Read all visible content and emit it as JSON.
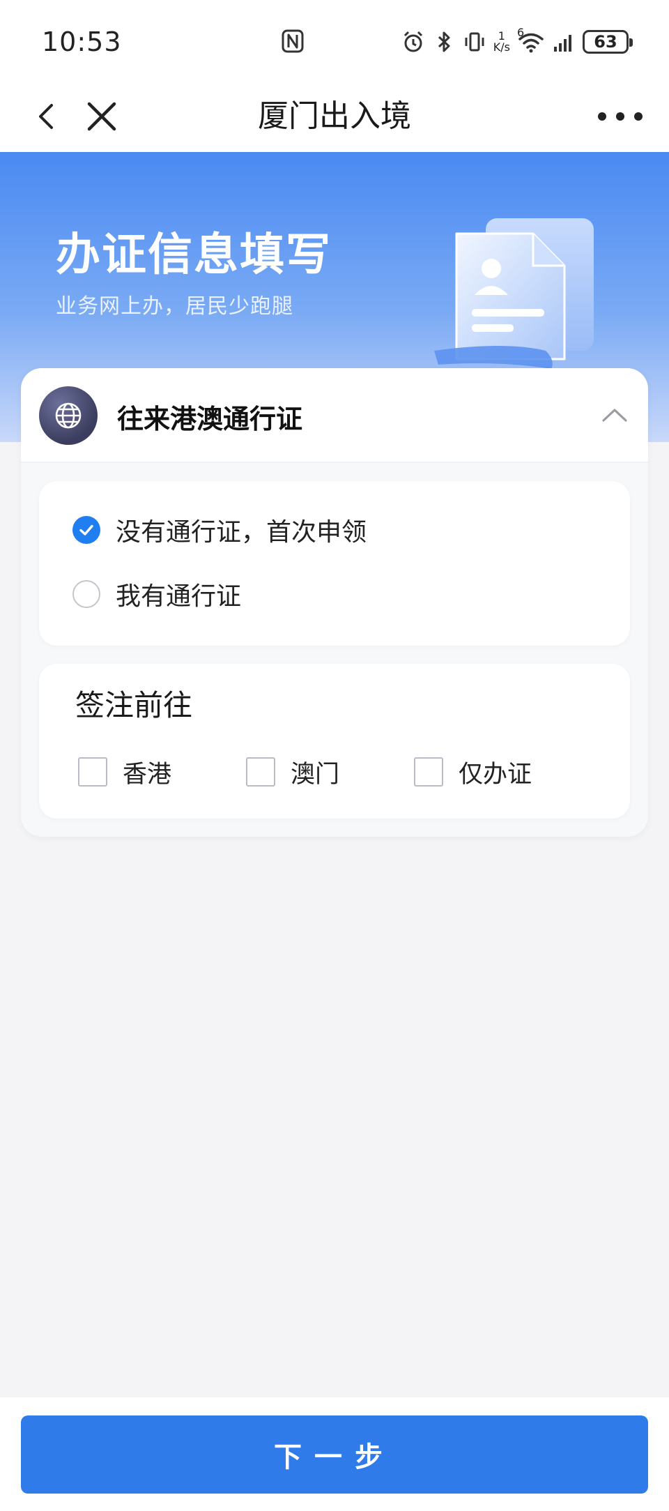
{
  "status_bar": {
    "time": "10:53",
    "net_speed_value": "1",
    "net_speed_unit": "K/s",
    "signal_label": "6",
    "battery": "63",
    "icons": [
      "nfc-icon",
      "alarm-icon",
      "bluetooth-icon",
      "vibrate-icon",
      "wifi-icon",
      "cell-signal-icon",
      "battery-icon"
    ]
  },
  "nav": {
    "title": "厦门出入境",
    "back_icon": "chevron-left-icon",
    "close_icon": "close-icon",
    "more_icon": "more-dots-icon"
  },
  "hero": {
    "title": "办证信息填写",
    "subtitle": "业务网上办，居民少跑腿",
    "accent_top": "#4a8af2",
    "accent_bottom": "#c9d8fa"
  },
  "card": {
    "title": "往来港澳通行证",
    "badge_icon": "globe-icon",
    "toggle_icon": "chevron-up-icon",
    "options": [
      {
        "label": "没有通行证，首次申领",
        "checked": true
      },
      {
        "label": "我有通行证",
        "checked": false
      }
    ],
    "endorsement": {
      "title": "签注前往",
      "choices": [
        {
          "label": "香港",
          "checked": false
        },
        {
          "label": "澳门",
          "checked": false
        },
        {
          "label": "仅办证",
          "checked": false
        }
      ]
    }
  },
  "footer": {
    "next_label": "下一步",
    "button_color": "#2f7bea"
  },
  "colors": {
    "primary": "#1f7ef0",
    "page_background": "#f4f4f6"
  }
}
